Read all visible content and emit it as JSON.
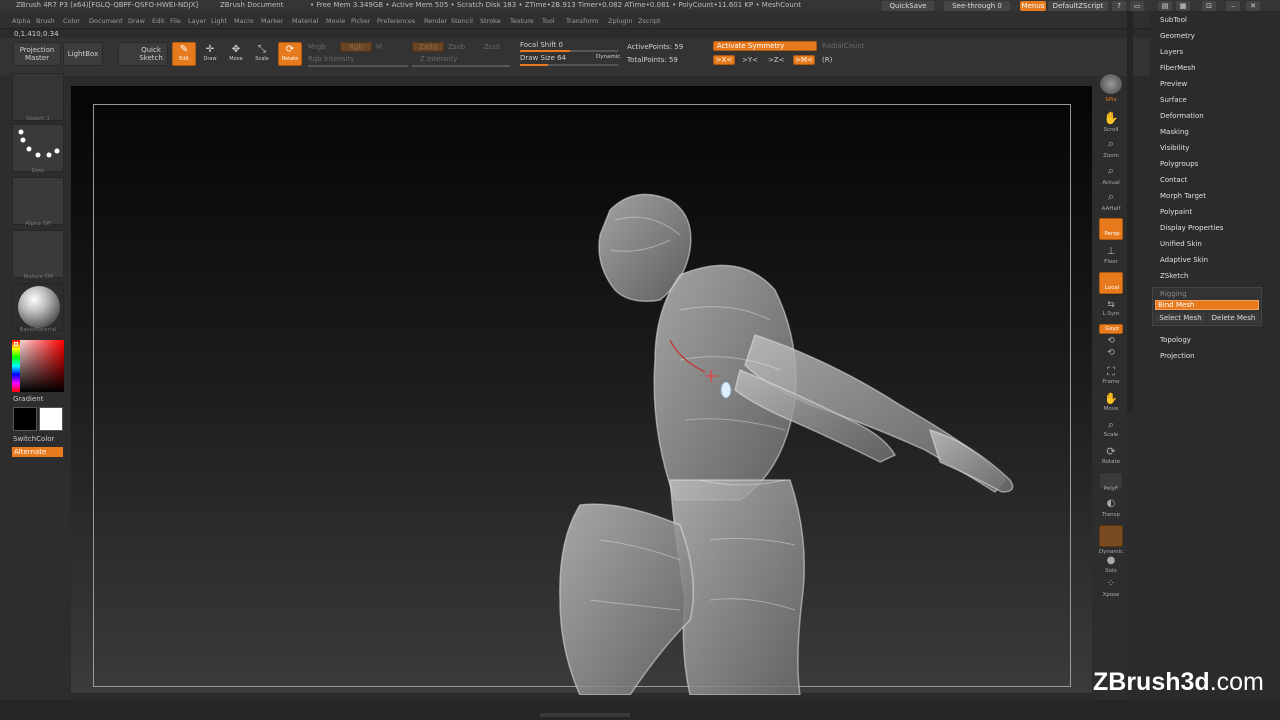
{
  "titlebar": {
    "app": "ZBrush 4R7 P3 (x64)[FGLQ-QBPF-QSFO-HWEI-NDJX]",
    "document": "ZBrush Document",
    "stats": "• Free Mem 3.349GB • Active Mem 505 • Scratch Disk 183 • ZTime•2B.913 Timer•0.082 ATime•0.081 • PolyCount•11.601 KP • MeshCount",
    "quicksave": "QuickSave",
    "seethrough": "See-through 0",
    "menus": "Menus",
    "defaultzscript": "DefaultZScript"
  },
  "menubar": [
    "Alpha",
    "Brush",
    "Color",
    "Document",
    "Draw",
    "Edit",
    "File",
    "Layer",
    "Light",
    "Macro",
    "Marker",
    "Material",
    "Movie",
    "Picker",
    "Preferences",
    "Render",
    "Stencil",
    "Stroke",
    "Texture",
    "Tool",
    "Transform",
    "Zplugin",
    "Zscript"
  ],
  "coords": "0,1.410,0.34",
  "shelf": {
    "projection_master": "Projection Master",
    "lightbox": "LightBox",
    "quick_sketch": "Quick Sketch",
    "edit": "Edit",
    "draw": "Draw",
    "move": "Move",
    "scale": "Scale",
    "rotate": "Rotate",
    "mrgb": "Mrgb",
    "rgb": "Rgb",
    "m": "M",
    "rgb_intensity": "Rgb Intensity",
    "zadd": "Zadd",
    "zsub": "Zsub",
    "zcut": "Zcut",
    "z_intensity": "Z Intensity",
    "focal_shift": "Focal Shift 0",
    "draw_size": "Draw Size 64",
    "dynamic": "Dynamic",
    "active_points": "ActivePoints: 59",
    "total_points": "TotalPoints: 59",
    "activate_symmetry": "Activate Symmetry",
    "radial_count": "RadialCount",
    "sym_x": ">X<",
    "sym_y": ">Y<",
    "sym_z": ">Z<",
    "sym_m": ">M<",
    "sym_r": "(R)"
  },
  "lefttray": {
    "stroke_label": "Sketch 1",
    "brush_label": "Dots",
    "alpha_label": "Alpha Off",
    "texture_label": "Texture Off",
    "material_label": "BasicMaterial",
    "gradient": "Gradient",
    "switchcolor": "SwitchColor",
    "alternate": "Alternate"
  },
  "rightshelf": {
    "spix": "SPix",
    "scroll": "Scroll",
    "zoom": "Zoom",
    "actual": "Actual",
    "aahalf": "AAHalf",
    "persp": "Persp",
    "floor": "Floor",
    "local": "Local",
    "lsym": "L.Sym",
    "gxyz": "Gxyz",
    "frame": "Frame",
    "move": "Move",
    "scale": "Scale",
    "rotate": "Rotate",
    "polyf": "PolyF",
    "transp": "Transp",
    "dynamic": "Dynamic",
    "solo": "Solo",
    "xpose": "Xpose"
  },
  "palette": {
    "items": [
      "SubTool",
      "Geometry",
      "Layers",
      "FiberMesh",
      "Preview",
      "Surface",
      "Deformation",
      "Masking",
      "Visibility",
      "Polygroups",
      "Contact",
      "Morph Target",
      "Polypaint",
      "Display Properties",
      "Unified Skin",
      "Adaptive Skin",
      "ZSketch"
    ],
    "rigging": "Rigging",
    "bind_mesh": "Bind Mesh",
    "select_mesh": "Select Mesh",
    "delete_mesh": "Delete Mesh",
    "topology": "Topology",
    "projection": "Projection"
  },
  "watermark": {
    "brand": "ZBrush3d",
    "tld": ".com"
  },
  "colors": {
    "accent": "#e87a1e",
    "panel": "#2d2d2d",
    "text": "#d0d0d0"
  }
}
